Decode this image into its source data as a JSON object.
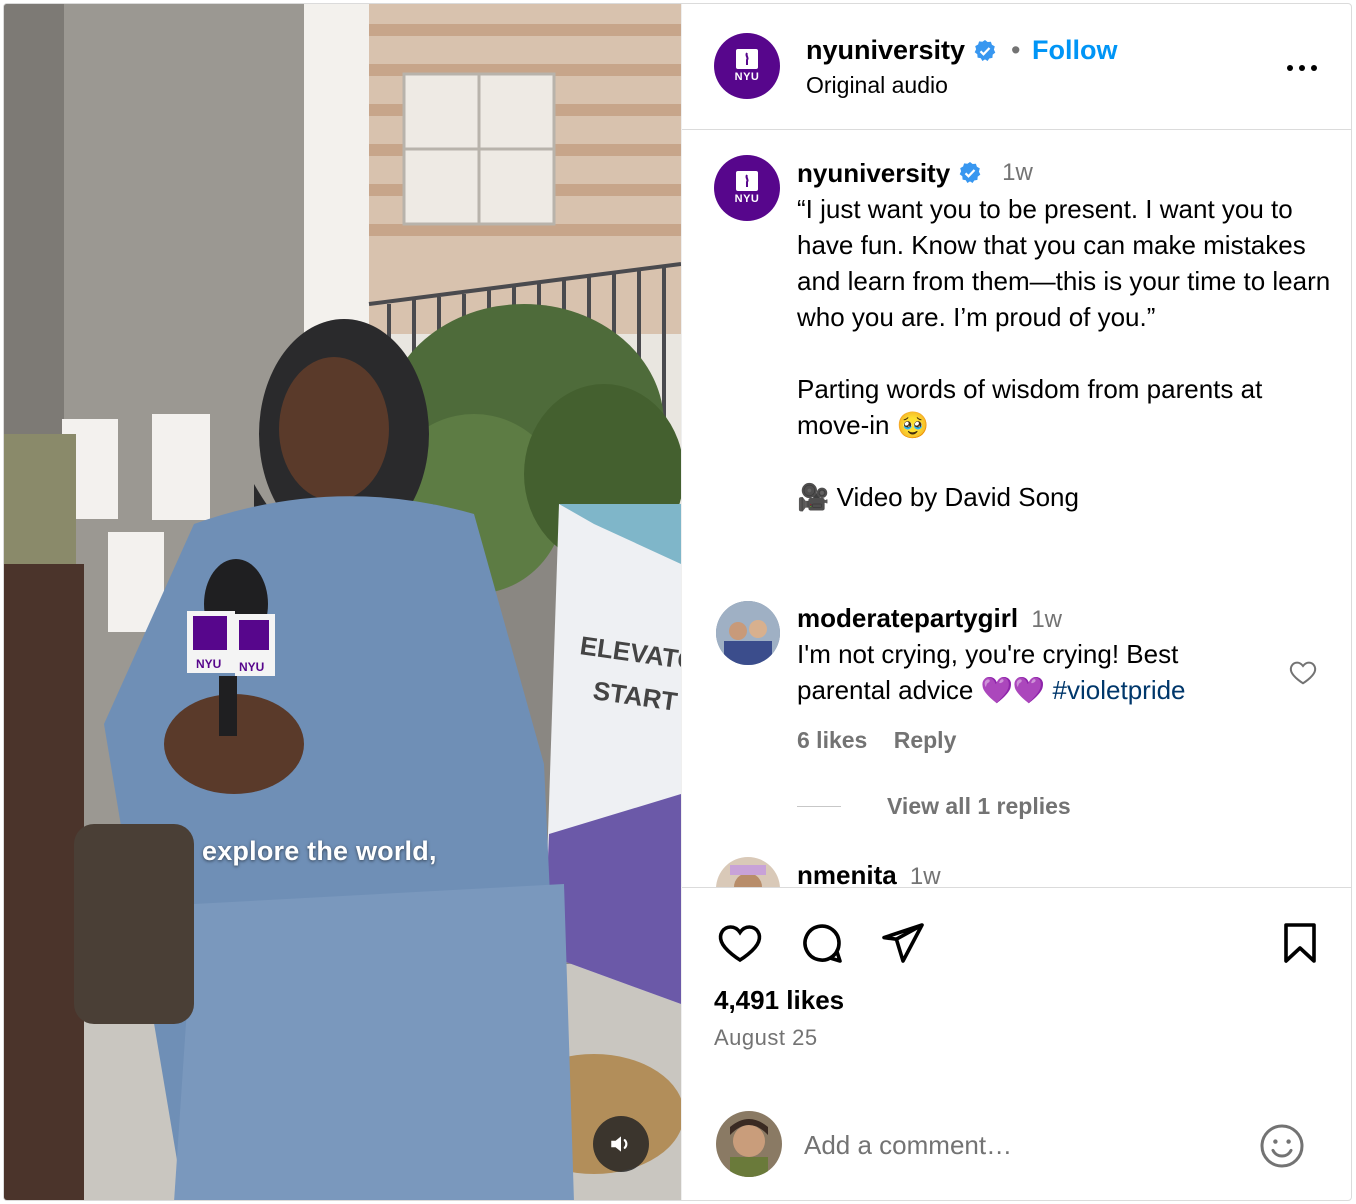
{
  "video": {
    "caption": "explore the world,",
    "mic_flag_left": "NYU",
    "mic_flag_right": "NYU",
    "sign_text_1": "ELEVATOR",
    "sign_text_2": "START HE"
  },
  "header": {
    "username": "nyuniversity",
    "separator": "•",
    "follow_label": "Follow",
    "audio": "Original audio",
    "avatar_text": "NYU"
  },
  "post": {
    "author": "nyuniversity",
    "time": "1w",
    "avatar_text": "NYU",
    "caption_paragraphs": [
      "“I just want you to be present. I want you to have fun. Know that you can make mistakes and learn from them—this is your time to learn who you are. I’m proud of you.”",
      "Parting words of wisdom from parents at move-in 🥹",
      "🎥 Video by David Song"
    ]
  },
  "comments": [
    {
      "user": "moderatepartygirl",
      "time": "1w",
      "text": "I'm not crying, you're crying! Best parental advice 💜💜",
      "hashtag": "#violetpride",
      "likes": "6 likes",
      "reply_label": "Reply",
      "view_replies": "View all 1 replies"
    },
    {
      "user": "nmenita",
      "time": "1w"
    }
  ],
  "actions": {
    "likes": "4,491 likes",
    "date": "August 25",
    "comment_placeholder": "Add a comment…"
  },
  "colors": {
    "brand_purple": "#57068c",
    "follow_blue": "#0095f6",
    "verified_blue": "#3897f0",
    "hashtag": "#00376b",
    "muted": "#737373"
  }
}
